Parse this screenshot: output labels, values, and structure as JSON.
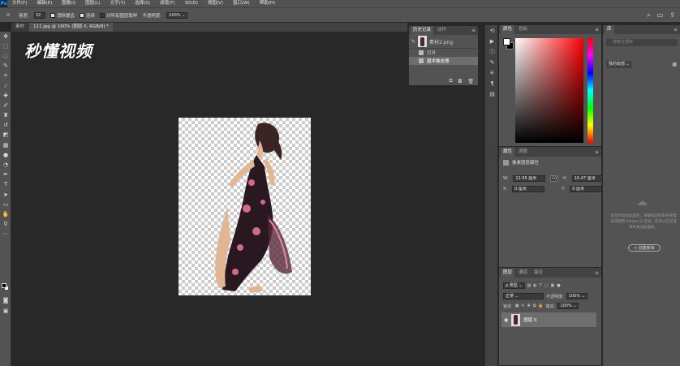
{
  "menubar": {
    "logo": "Ps",
    "items": [
      "文件(F)",
      "编辑(E)",
      "图像(I)",
      "图层(L)",
      "文字(Y)",
      "选择(S)",
      "滤镜(T)",
      "3D(D)",
      "视图(V)",
      "窗口(W)",
      "帮助(H)"
    ]
  },
  "options_bar": {
    "feather_label": "容差:",
    "feather_value": "32",
    "antialias_label": "消除锯齿",
    "contiguous_label": "连续",
    "sample_all_label": "对所有图层取样",
    "opacity_label": "不透明度:",
    "opacity_value": "100%"
  },
  "tabs": [
    "素材",
    "111.jpg @ 100% (图层 0, RGB/8) *"
  ],
  "watermark": "秒懂视频",
  "history_panel": {
    "tabs": [
      "历史记录",
      "动作"
    ],
    "snapshot": "素材2.png",
    "steps": [
      "打开",
      "魔术橡皮擦"
    ]
  },
  "color_panel": {
    "tabs": [
      "颜色",
      "色板"
    ]
  },
  "properties_panel": {
    "tabs": [
      "属性",
      "调整"
    ],
    "title": "像素图层属性",
    "w_label": "W:",
    "w_value": "12.95 厘米",
    "link_label": "GO",
    "h_label": "H:",
    "h_value": "16.47 厘米",
    "x_label": "X:",
    "x_value": "0 厘米",
    "y_label": "Y:",
    "y_value": "0 厘米"
  },
  "layers_panel": {
    "tabs": [
      "图层",
      "通道",
      "路径"
    ],
    "kind_filter": "ρ 类型",
    "blend_mode": "正常",
    "opacity_label": "不透明度:",
    "opacity_value": "100%",
    "lock_label": "锁定:",
    "fill_label": "填充:",
    "fill_value": "100%",
    "layer_name": "图层 0"
  },
  "libraries_panel": {
    "tab": "库",
    "search_placeholder": "搜索全部库",
    "dropdown": "我的库部",
    "message": "您无权访问此服务，请联系您的系统管理员或使用 Adobe ID 登录。您可以在首选项中关闭此面板。",
    "create_button": "+ 创建新库"
  },
  "colors": {
    "panel_bg": "#535353",
    "canvas_bg": "#282828",
    "selected_row": "#6e6e6e",
    "accent": "#31a8ff"
  }
}
